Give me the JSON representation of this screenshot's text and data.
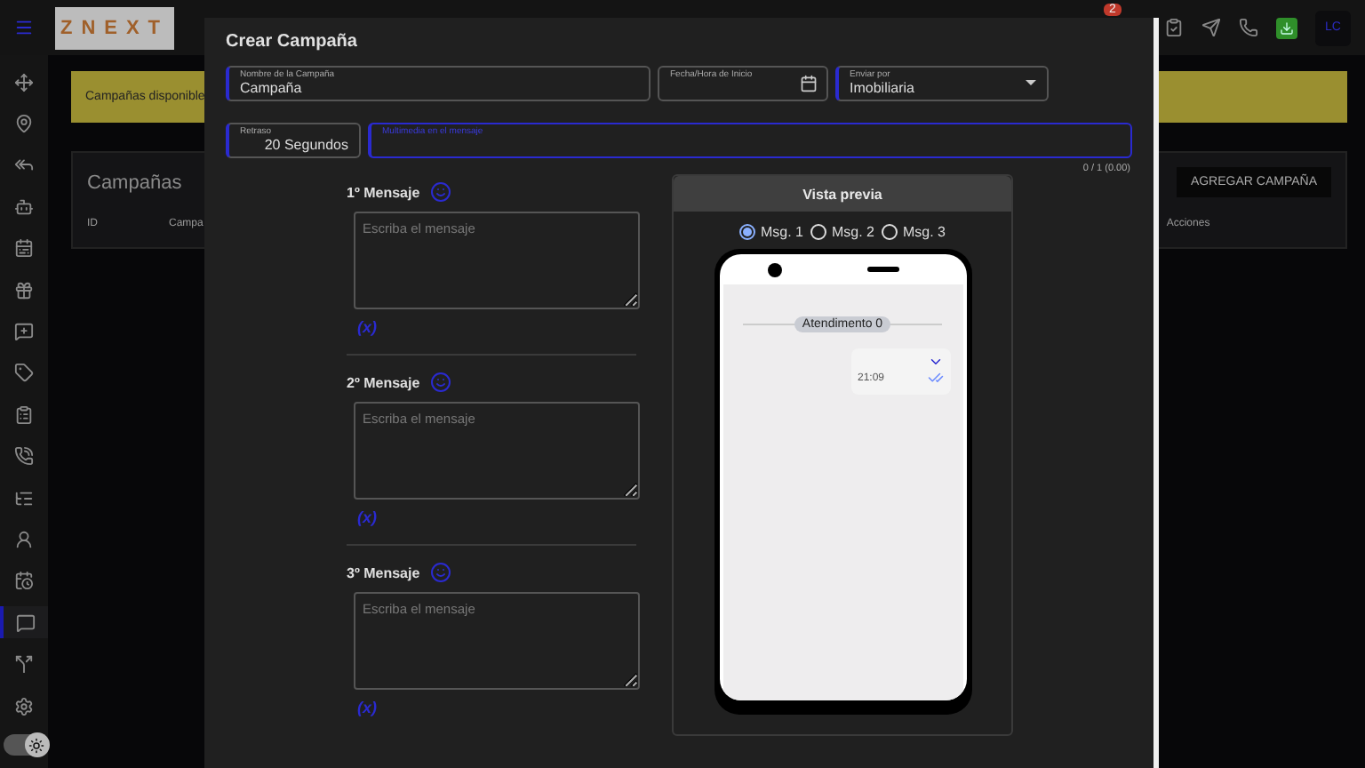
{
  "topbar": {
    "logo": "ZNEXT",
    "notification_count": "2",
    "avatar_initials": "LC"
  },
  "sidebar": {
    "items": [
      {
        "kind": "move",
        "selected": false
      },
      {
        "kind": "person-pin",
        "selected": false
      },
      {
        "kind": "reply-all",
        "selected": false
      },
      {
        "kind": "robot",
        "selected": false
      },
      {
        "kind": "calendar-list",
        "selected": false
      },
      {
        "kind": "gift",
        "selected": false
      },
      {
        "kind": "message-plus",
        "selected": false
      },
      {
        "kind": "tag",
        "selected": false
      },
      {
        "kind": "clipboard",
        "selected": false
      },
      {
        "kind": "phone",
        "selected": false
      },
      {
        "kind": "list",
        "selected": false
      },
      {
        "kind": "users",
        "selected": false
      },
      {
        "kind": "calendar-clock",
        "selected": false
      },
      {
        "kind": "message-square",
        "selected": true
      },
      {
        "kind": "split",
        "selected": false
      },
      {
        "kind": "settings",
        "selected": false
      }
    ],
    "theme_toggle": {
      "on": true
    }
  },
  "page": {
    "banner": "Campañas disponible",
    "card_title": "Campañas",
    "add_button": "AGREGAR CAMPAÑA",
    "columns": [
      "ID",
      "Campa",
      "Acciones"
    ]
  },
  "modal": {
    "title": "Crear Campaña",
    "fields": [
      {
        "kind": "text",
        "label": "Nombre de la Campaña",
        "value": "Campaña",
        "required": true,
        "focused": false
      },
      {
        "kind": "date",
        "label": "Fecha/Hora de Inicio",
        "required": false,
        "focused": false
      },
      {
        "kind": "select",
        "label": "Enviar por",
        "value": "Imobiliaria",
        "required": true,
        "focused": false
      },
      {
        "kind": "number",
        "label": "Retraso",
        "value": "20 Segundos",
        "required": true,
        "focused": false
      },
      {
        "kind": "file",
        "label": "Multimedia en el mensaje",
        "required": true,
        "focused": true
      }
    ],
    "counter": "0 / 1 (0.00)",
    "messages": [
      {
        "label": "1º Mensaje",
        "placeholder": "Escriba el mensaje",
        "variables": "(x)"
      },
      {
        "label": "2º Mensaje",
        "placeholder": "Escriba el mensaje",
        "variables": "(x)"
      },
      {
        "label": "3º Mensaje",
        "placeholder": "Escriba el mensaje",
        "variables": "(x)"
      }
    ],
    "preview": {
      "title": "Vista previa",
      "options": [
        {
          "label": "Msg. 1",
          "selected": true
        },
        {
          "label": "Msg. 2",
          "selected": false
        },
        {
          "label": "Msg. 3",
          "selected": false
        }
      ],
      "chip": "Atendimento 0",
      "time": "21:09"
    }
  }
}
